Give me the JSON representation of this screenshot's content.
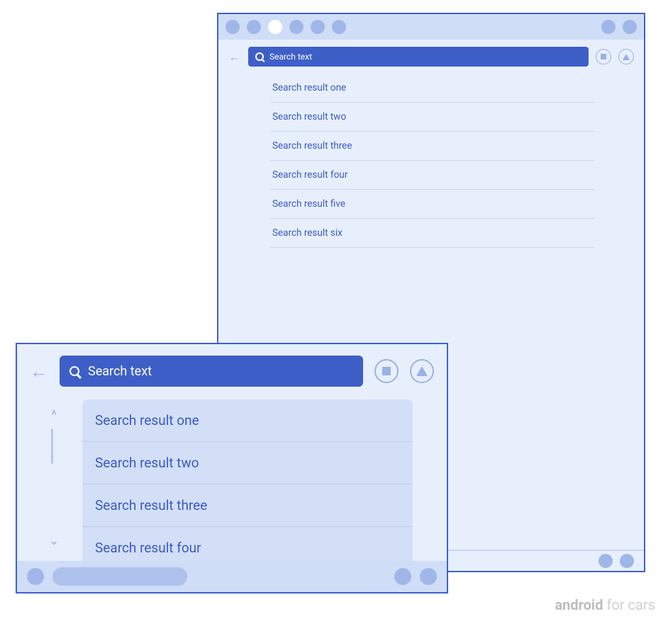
{
  "search": {
    "value": "Search text"
  },
  "results_back": [
    "Search result one",
    "Search result two",
    "Search result three",
    "Search result four",
    "Search result five",
    "Search result six"
  ],
  "results_front": [
    "Search result one",
    "Search result two",
    "Search result three",
    "Search result four"
  ],
  "watermark": {
    "brand": "android",
    "suffix": " for cars"
  }
}
